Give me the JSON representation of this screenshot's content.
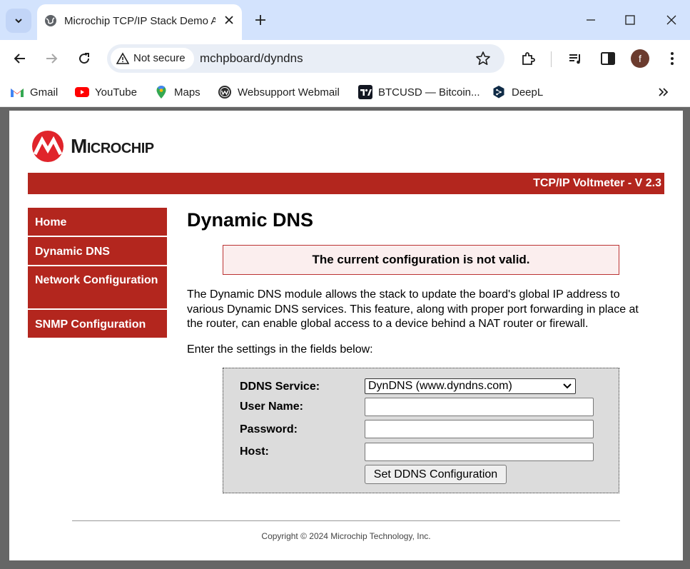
{
  "browser": {
    "tab_title": "Microchip TCP/IP Stack Demo A",
    "security_label": "Not secure",
    "url": "mchpboard/dyndns",
    "profile_initial": "f",
    "bookmarks": [
      {
        "label": "Gmail",
        "icon": "gmail-icon"
      },
      {
        "label": "YouTube",
        "icon": "youtube-icon"
      },
      {
        "label": "Maps",
        "icon": "maps-icon"
      },
      {
        "label": "Websupport Webmail",
        "icon": "websupport-icon"
      },
      {
        "label": "BTCUSD — Bitcoin...",
        "icon": "tradingview-icon"
      },
      {
        "label": "DeepL",
        "icon": "deepl-icon"
      }
    ]
  },
  "page": {
    "logo_text": "Microchip",
    "banner": "TCP/IP Voltmeter - V 2.3",
    "menu": [
      {
        "label": "Home"
      },
      {
        "label": "Dynamic DNS"
      },
      {
        "label": "Network Configuration"
      },
      {
        "label": "SNMP Configuration"
      }
    ],
    "heading": "Dynamic DNS",
    "error": "The current configuration is not valid.",
    "description": "The Dynamic DNS module allows the stack to update the board's global IP address to various Dynamic DNS services. This feature, along with proper port forwarding in place at the router, can enable global access to a device behind a NAT router or firewall.",
    "instructions": "Enter the settings in the fields below:",
    "form": {
      "service_label": "DDNS Service:",
      "service_value": "DynDNS (www.dyndns.com)",
      "username_label": "User Name:",
      "username_value": "",
      "password_label": "Password:",
      "password_value": "",
      "host_label": "Host:",
      "host_value": "",
      "submit_label": "Set DDNS Configuration"
    },
    "footer": "Copyright © 2024 Microchip Technology, Inc."
  },
  "colors": {
    "brand_red": "#b3261e",
    "tabstrip": "#d3e3fd",
    "form_bg": "#dcdcdc"
  }
}
